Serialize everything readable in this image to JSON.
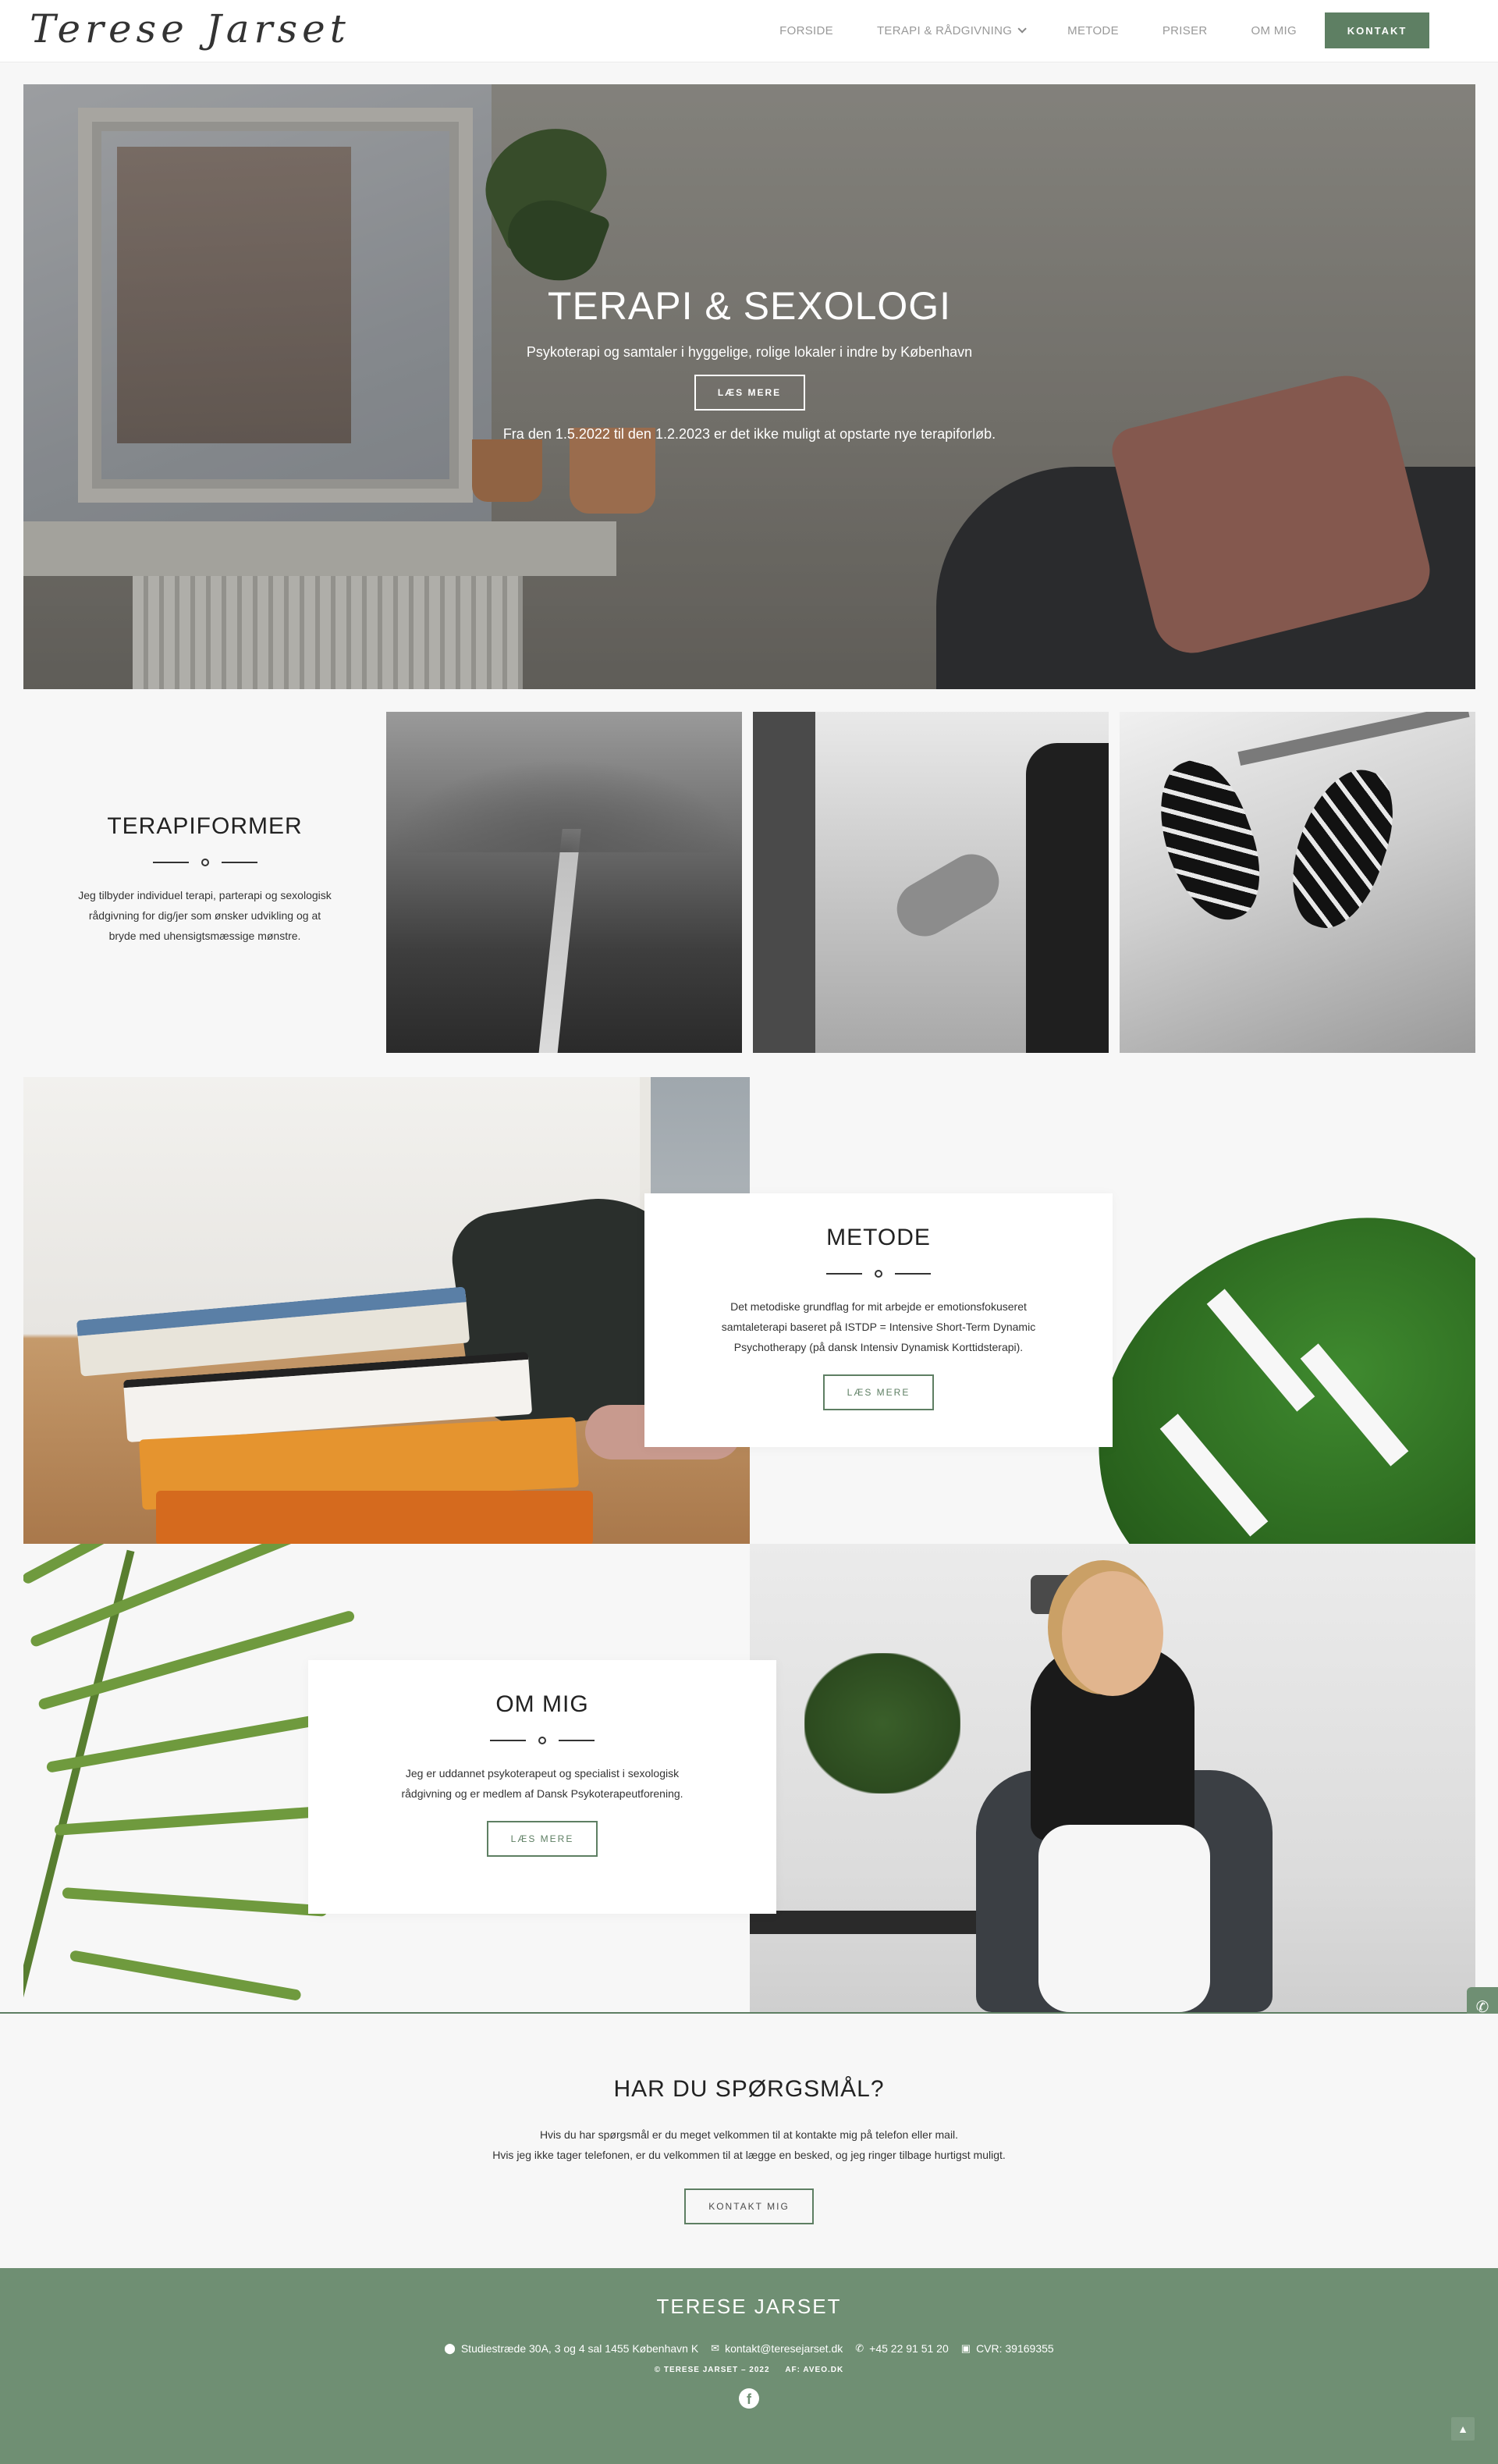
{
  "header": {
    "logo": "Terese Jarset",
    "nav": [
      "FORSIDE",
      "TERAPI & RÅDGIVNING",
      "METODE",
      "PRISER",
      "OM MIG"
    ],
    "cta": "KONTAKT"
  },
  "hero": {
    "title": "TERAPI & SEXOLOGI",
    "subtitle": "Psykoterapi og samtaler i hyggelige, rolige lokaler i indre by København",
    "button": "LÆS MERE",
    "note": "Fra den 1.5.2022 til den 1.2.2023 er det ikke muligt at opstarte nye terapiforløb."
  },
  "terapiformer": {
    "title": "TERAPIFORMER",
    "text": "Jeg tilbyder individuel terapi, parterapi og sexologisk rådgivning for dig/jer som ønsker udvikling og at bryde med uhensigtsmæssige mønstre."
  },
  "metode": {
    "title": "METODE",
    "text": "Det metodiske grundflag for mit arbejde er emotionsfokuseret samtaleterapi baseret på ISTDP = Intensive Short-Term Dynamic Psychotherapy (på dansk Intensiv Dynamisk Korttidsterapi).",
    "button": "LÆS MERE"
  },
  "ommig": {
    "title": "OM MIG",
    "text": "Jeg er uddannet psykoterapeut og specialist i sexologisk rådgivning og er medlem af Dansk Psykoterapeutforening.",
    "button": "LÆS MERE"
  },
  "questions": {
    "title": "HAR DU SPØRGSMÅL?",
    "line1": "Hvis du har spørgsmål er du meget velkommen til at kontakte mig på telefon eller mail.",
    "line2": "Hvis jeg ikke tager telefonen, er du velkommen til at lægge en besked, og jeg ringer tilbage hurtigst muligt.",
    "button": "KONTAKT MIG"
  },
  "footer": {
    "title": "TERESE JARSET",
    "address": "Studiestræde 30A, 3 og 4 sal 1455 København K",
    "email": "kontakt@teresejarset.dk",
    "phone": "+45 22 91 51 20",
    "cvr": "CVR: 39169355",
    "copyright": "© TERESE JARSET – 2022",
    "credit": "AF: AVEO.DK"
  },
  "icons": {
    "pin": "map-pin-icon",
    "mail": "envelope-icon",
    "phone": "phone-icon",
    "cvr": "briefcase-icon",
    "facebook": "facebook-icon",
    "top": "arrow-up-icon"
  },
  "colors": {
    "accent": "#5e7f63",
    "footer": "#6f8f73"
  }
}
